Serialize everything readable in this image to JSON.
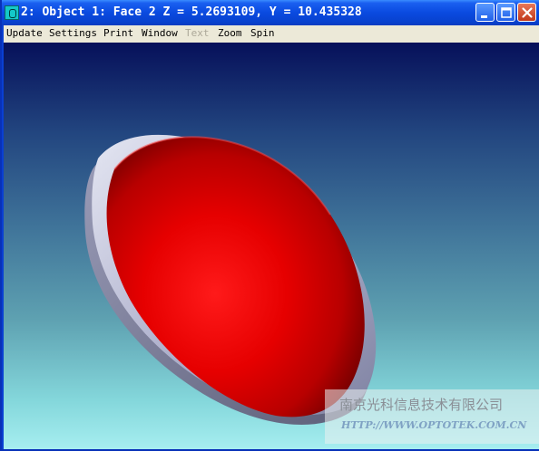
{
  "window": {
    "title": "2: Object 1: Face 2 Z = 5.2693109, Y = 10.435328",
    "controls": {
      "minimize": "minimize-icon",
      "maximize": "maximize-icon",
      "close": "close-icon"
    }
  },
  "menu": {
    "items": [
      {
        "label": "Update",
        "enabled": true
      },
      {
        "label": "Settings",
        "enabled": true
      },
      {
        "label": "Print",
        "enabled": true
      },
      {
        "label": "Window",
        "enabled": true
      },
      {
        "label": "Text",
        "enabled": false
      },
      {
        "label": "Zoom",
        "enabled": true
      },
      {
        "label": "Spin",
        "enabled": true
      }
    ]
  },
  "scene": {
    "object_color": "#e00000",
    "mount_color": "#b4b8d0",
    "background_top": "#06105a",
    "background_bottom": "#a6eef0"
  },
  "watermark": {
    "line1": "南京光科信息技术有限公司",
    "line2": "HTTP://WWW.OPTOTEK.COM.CN"
  }
}
